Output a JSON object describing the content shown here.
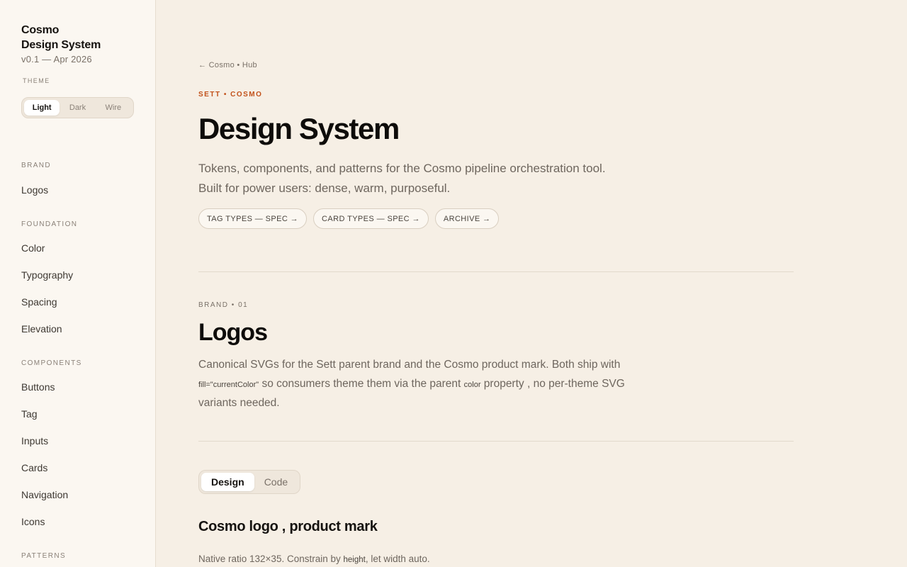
{
  "sidebar": {
    "brand_line1": "Cosmo",
    "brand_line2": "Design System",
    "version": "v0.1 — Apr 2026",
    "theme_label": "THEME",
    "theme_options": [
      "Light",
      "Dark",
      "Wire"
    ],
    "theme_selected": "Light",
    "groups": [
      {
        "label": "BRAND",
        "items": [
          "Logos"
        ]
      },
      {
        "label": "FOUNDATION",
        "items": [
          "Color",
          "Typography",
          "Spacing",
          "Elevation"
        ]
      },
      {
        "label": "COMPONENTS",
        "items": [
          "Buttons",
          "Tag",
          "Inputs",
          "Cards",
          "Navigation",
          "Icons"
        ]
      },
      {
        "label": "PATTERNS",
        "items": []
      }
    ]
  },
  "header": {
    "back_link": "← Cosmo • Hub",
    "eyebrow": "SETT • COSMO",
    "title": "Design System",
    "lede_line1": "Tokens, components, and patterns for the Cosmo pipeline orchestration tool.",
    "lede_line2": "Built for power users: dense, warm, purposeful.",
    "chips": [
      "TAG TYPES — SPEC →",
      "CARD TYPES — SPEC →",
      "ARCHIVE →"
    ]
  },
  "section": {
    "eyebrow": "BRAND • 01",
    "title": "Logos",
    "desc_part1": "Canonical SVGs for the Sett parent brand and the Cosmo product mark. Both ship with",
    "desc_code1": "fill=\"currentColor\"",
    "desc_part2": " so consumers theme them via the parent ",
    "desc_code2": "color",
    "desc_part3": " property , no per-theme SVG variants needed.",
    "tabs": [
      "Design",
      "Code"
    ],
    "tab_selected": "Design",
    "subsection_title": "Cosmo logo , product mark",
    "subsection_desc_part1": "Native ratio 132×35. Constrain by ",
    "subsection_desc_code": "height",
    "subsection_desc_part2": ", let width auto."
  },
  "colors": {
    "accent": "#c2521b",
    "background": "#f6efe5",
    "sidebar_bg": "#fbf7f1"
  }
}
